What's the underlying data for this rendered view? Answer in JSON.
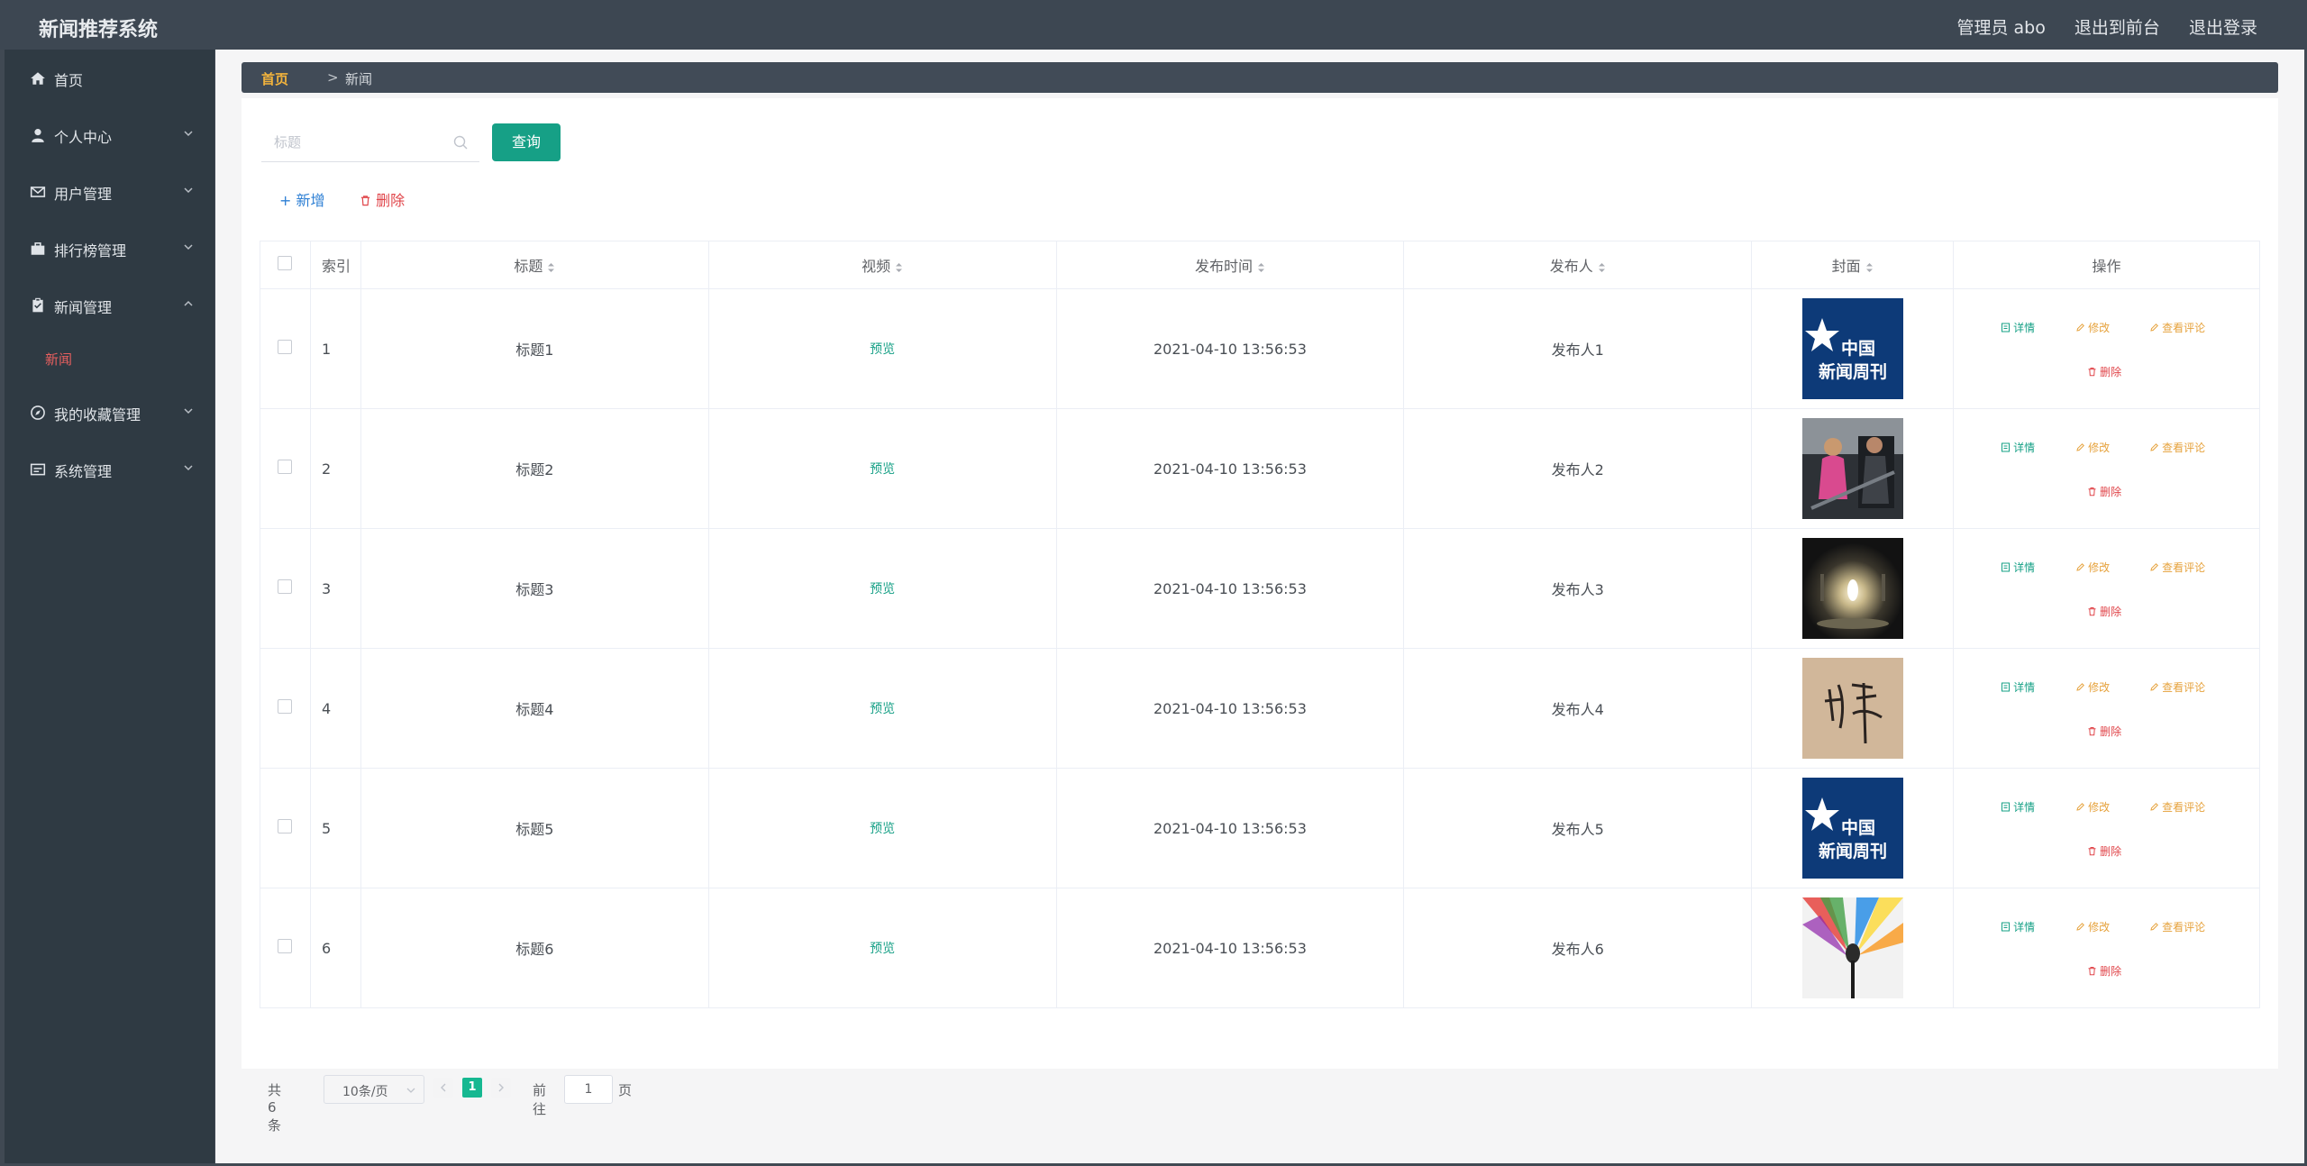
{
  "header": {
    "app_title": "新闻推荐系统",
    "admin_label": "管理员 abo",
    "front_label": "退出到前台",
    "logout_label": "退出登录"
  },
  "sidebar": {
    "items": [
      {
        "label": "首页",
        "icon": "home-icon"
      },
      {
        "label": "个人中心",
        "icon": "user-icon"
      },
      {
        "label": "用户管理",
        "icon": "mail-icon"
      },
      {
        "label": "排行榜管理",
        "icon": "briefcase-icon"
      },
      {
        "label": "新闻管理",
        "icon": "clipboard-icon",
        "expanded": true
      },
      {
        "label": "我的收藏管理",
        "icon": "compass-icon"
      },
      {
        "label": "系统管理",
        "icon": "system-icon"
      }
    ],
    "active_subitem": "新闻"
  },
  "breadcrumb": {
    "home": "首页",
    "separator": ">",
    "current": "新闻"
  },
  "search": {
    "placeholder": "标题",
    "value": "",
    "button_label": "查询"
  },
  "actions": {
    "add_label": "新增",
    "delete_label": "删除"
  },
  "table": {
    "headers": {
      "index": "索引",
      "title": "标题",
      "video": "视频",
      "publish_time": "发布时间",
      "publisher": "发布人",
      "cover": "封面",
      "operations": "操作"
    },
    "preview_label": "预览",
    "op_labels": {
      "detail": "详情",
      "edit": "修改",
      "comment": "查看评论",
      "delete": "删除"
    },
    "rows": [
      {
        "index": "1",
        "title": "标题1",
        "time": "2021-04-10 13:56:53",
        "publisher": "发布人1",
        "cover": "china-news-weekly-logo"
      },
      {
        "index": "2",
        "title": "标题2",
        "time": "2021-04-10 13:56:53",
        "publisher": "发布人2",
        "cover": "gym-photo"
      },
      {
        "index": "3",
        "title": "标题3",
        "time": "2021-04-10 13:56:53",
        "publisher": "发布人3",
        "cover": "light-bulb-photo"
      },
      {
        "index": "4",
        "title": "标题4",
        "time": "2021-04-10 13:56:53",
        "publisher": "发布人4",
        "cover": "calligraphy-photo"
      },
      {
        "index": "5",
        "title": "标题5",
        "time": "2021-04-10 13:56:53",
        "publisher": "发布人5",
        "cover": "china-news-weekly-logo"
      },
      {
        "index": "6",
        "title": "标题6",
        "time": "2021-04-10 13:56:53",
        "publisher": "发布人6",
        "cover": "stage-microphone-photo"
      }
    ]
  },
  "cover_logo_text": {
    "line1": "中国",
    "line2": "新闻周刊"
  },
  "pagination": {
    "total_label": "共 6 条",
    "page_size": "10条/页",
    "current_page": "1",
    "goto_label": "前往",
    "goto_value": "1",
    "page_suffix": "页"
  },
  "colors": {
    "accent": "#16a086",
    "danger": "#e0454a",
    "warning": "#e6a23c",
    "sidebar_bg": "#2f3a43",
    "header_bg": "#3d4752"
  }
}
